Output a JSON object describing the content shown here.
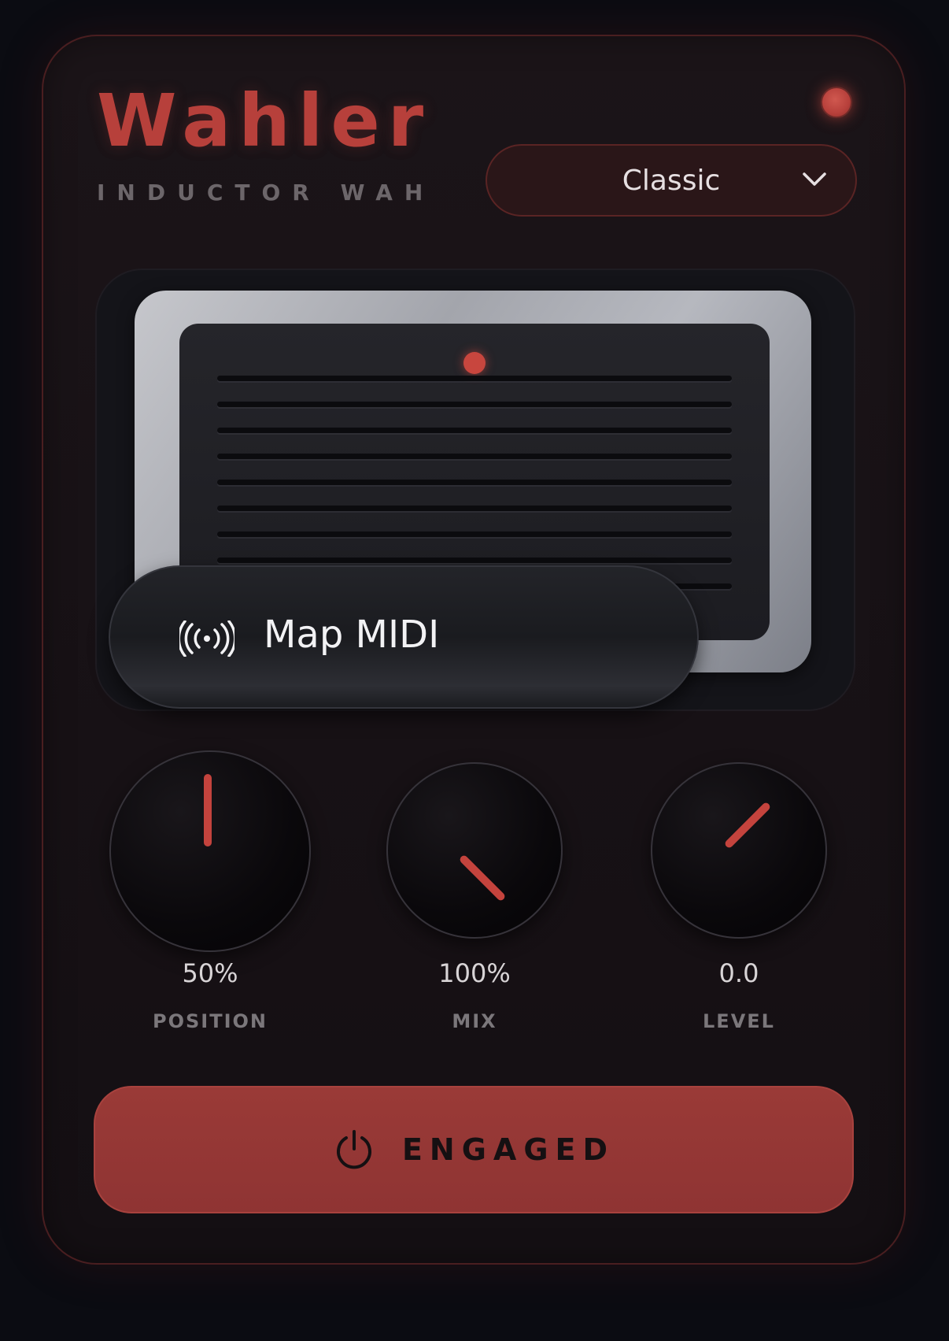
{
  "brand": {
    "title": "Wahler",
    "subtitle": "INDUCTOR WAH"
  },
  "preset": {
    "selected": "Classic"
  },
  "midi": {
    "label": "Map MIDI"
  },
  "knobs": [
    {
      "id": "position",
      "value": "50%",
      "label": "POSITION"
    },
    {
      "id": "mix",
      "value": "100%",
      "label": "MIX"
    },
    {
      "id": "level",
      "value": "0.0",
      "label": "LEVEL"
    }
  ],
  "engage": {
    "label": "ENGAGED",
    "state": "on"
  },
  "colors": {
    "accent": "#b7403b",
    "panel": "#1b1418",
    "background": "#0b0c12"
  },
  "icons": {
    "status": "status-led",
    "preset_dropdown": "chevron-down-icon",
    "midi": "broadcast-icon",
    "engage": "power-icon"
  }
}
